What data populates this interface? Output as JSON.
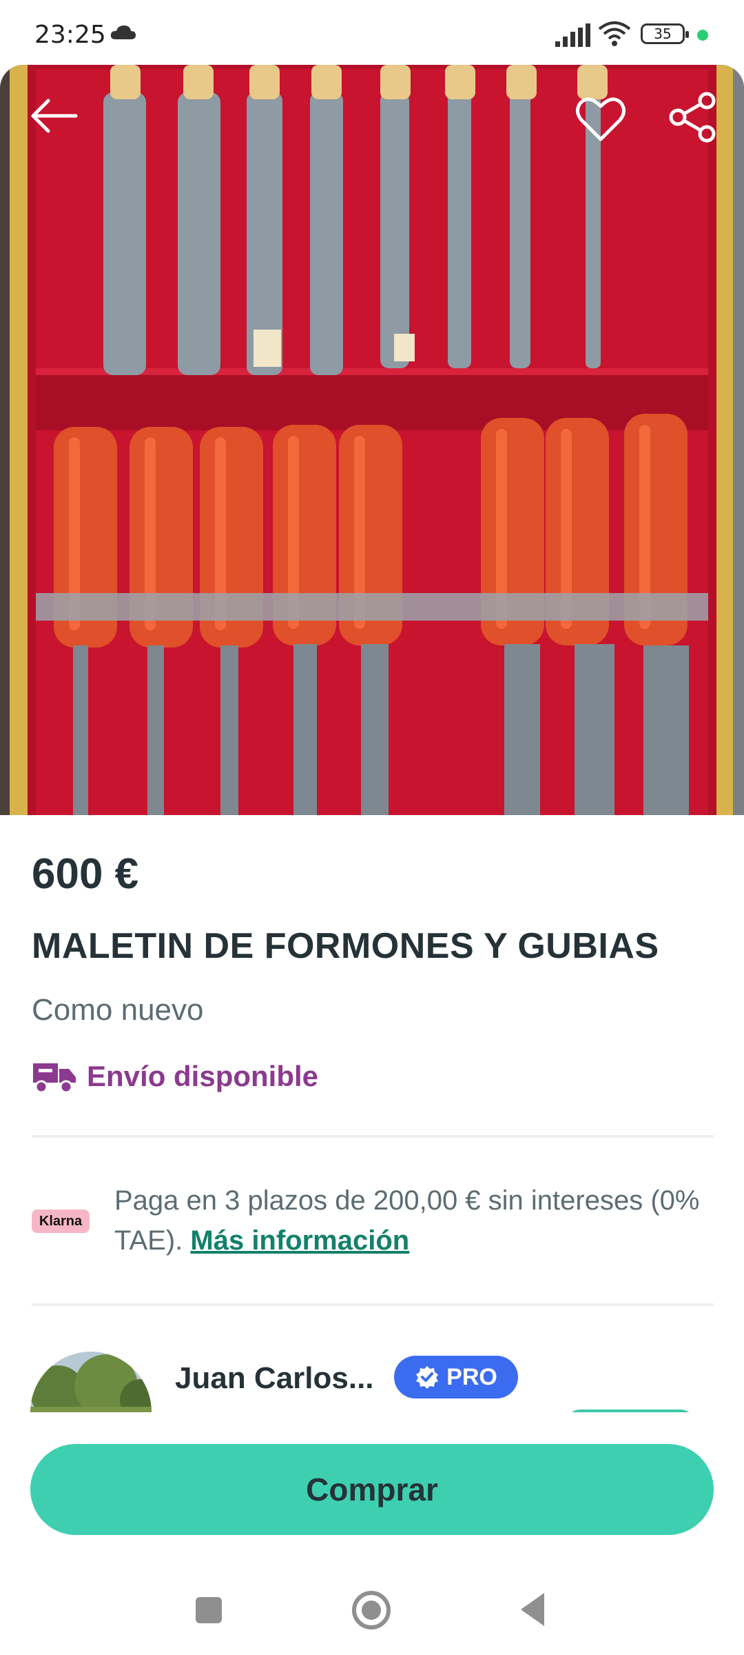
{
  "status_bar": {
    "time": "23:25",
    "battery": "35"
  },
  "product": {
    "price": "600 €",
    "title": "MALETIN DE FORMONES Y GUBIAS",
    "condition": "Como nuevo",
    "shipping": "Envío disponible",
    "image_count": 5,
    "active_image": 1
  },
  "klarna": {
    "badge": "Klarna",
    "text": "Paga en 3 plazos de 200,00 € sin intereses (0% TAE).",
    "link": "Más información"
  },
  "seller": {
    "name": "Juan Carlos...",
    "badge": "PRO"
  },
  "actions": {
    "buy": "Comprar"
  },
  "icons": {
    "back": "arrow-left-icon",
    "favorite": "heart-icon",
    "share": "share-icon",
    "shipping": "truck-icon",
    "verified": "verified-check-icon"
  },
  "colors": {
    "brand": "#3ecfb0",
    "shipping": "#8b3a8f",
    "link": "#13806b",
    "pro": "#3b6cf0",
    "klarna": "#f7b6c8"
  }
}
